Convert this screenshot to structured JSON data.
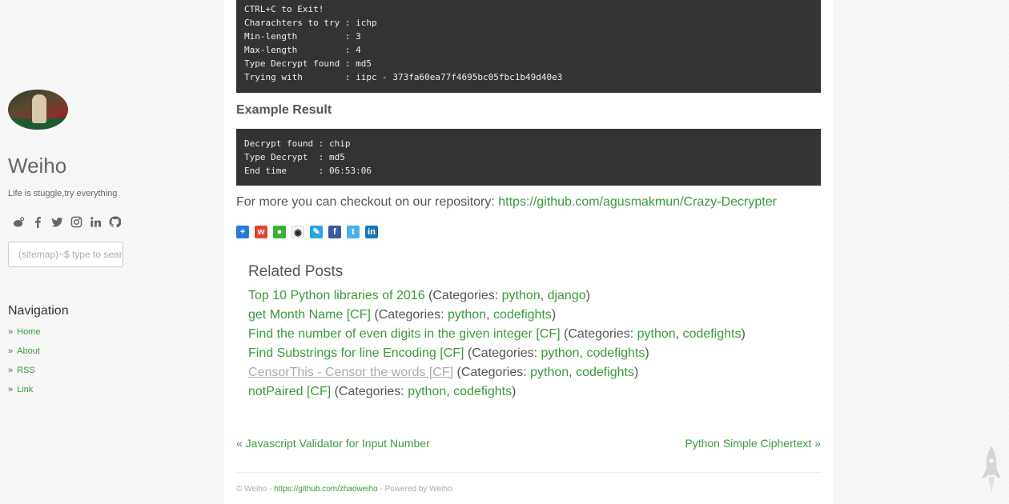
{
  "sidebar": {
    "title": "Weiho",
    "tagline": "Life is stuggle,try everything",
    "social": [
      "weibo-icon",
      "facebook-icon",
      "twitter-icon",
      "instagram-icon",
      "linkedin-icon",
      "github-icon"
    ],
    "search_placeholder": "(sitemap)~$ type to search",
    "nav_title": "Navigation",
    "nav_items": [
      {
        "label": "Home"
      },
      {
        "label": "About"
      },
      {
        "label": "RSS"
      },
      {
        "label": "Link"
      }
    ]
  },
  "main": {
    "code1": "CTRL+C to Exit!\nCharachters to try : ichp\nMin-length         : 3\nMax-length         : 4\nType Decrypt found : md5\nTrying with        : iipc - 373fa60ea77f4695bc05fbc1b49d40e3",
    "example_title": "Example Result",
    "code2": "Decrypt found : chip\nType Decrypt  : md5\nEnd time      : 06:53:06",
    "more_text": "For more you can checkout on our repository: ",
    "more_link": "https://github.com/agusmakmun/Crazy-Decrypter",
    "share_icons": [
      "share-plus-icon",
      "weibo-share-icon",
      "wechat-share-icon",
      "qq-share-icon",
      "tencent-share-icon",
      "facebook-share-icon",
      "twitter-share-icon",
      "linkedin-share-icon"
    ],
    "related_title": "Related Posts",
    "related": [
      {
        "title": "Top 10 Python libraries of 2016",
        "cats": [
          "python",
          "django"
        ]
      },
      {
        "title": "get Month Name [CF]",
        "cats": [
          "python",
          "codefights"
        ]
      },
      {
        "title": "Find the number of even digits in the given integer [CF]",
        "cats": [
          "python",
          "codefights"
        ]
      },
      {
        "title": "Find Substrings for line Encoding [CF]",
        "cats": [
          "python",
          "codefights"
        ]
      },
      {
        "title": "CensorThis - Censor the words [CF]",
        "cats": [
          "python",
          "codefights"
        ],
        "visited": true
      },
      {
        "title": "notPaired [CF]",
        "cats": [
          "python",
          "codefights"
        ]
      }
    ],
    "categories_prefix": " (Categories: ",
    "pager_prev": "« Javascript Validator for Input Number",
    "pager_next": "Python Simple Ciphertext »",
    "footer": {
      "copyright": "© Weiho - ",
      "link": "https://github.com/zhaoweiho",
      "powered": " - Powered by Weiho."
    }
  }
}
